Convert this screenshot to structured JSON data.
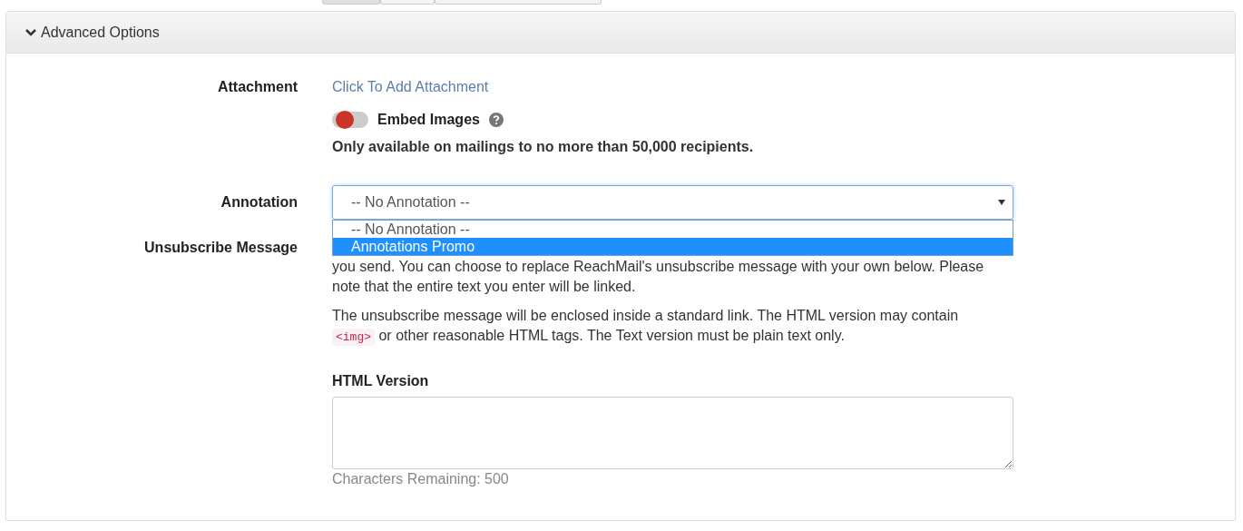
{
  "top_buttons": [
    {
      "selected": true
    },
    {
      "selected": false
    },
    {
      "selected": false
    }
  ],
  "panel": {
    "title": "Advanced Options",
    "expanded": true
  },
  "attachment": {
    "label": "Attachment",
    "link": "Click To Add Attachment"
  },
  "embed_images": {
    "label": "Embed Images",
    "on": false,
    "note": "Only available on mailings to no more than 50,000 recipients."
  },
  "annotation": {
    "label": "Annotation",
    "value": "-- No Annotation --",
    "options": [
      {
        "label": "-- No Annotation --",
        "highlighted": false
      },
      {
        "label": "Annotations Promo",
        "highlighted": true
      }
    ]
  },
  "unsubscribe": {
    "label": "Unsubscribe Message",
    "paragraphs": [
      "you send. You can choose to replace ReachMail's unsubscribe message with your own below. Please note that the entire text you enter will be linked."
    ],
    "note_code": "<img>",
    "note_before": "The unsubscribe message will be enclosed inside a standard link. The HTML version may contain",
    "note_after": "or other reasonable HTML tags. The Text version must be plain text only.",
    "html_label": "HTML Version",
    "remaining": "Characters Remaining: 500"
  }
}
